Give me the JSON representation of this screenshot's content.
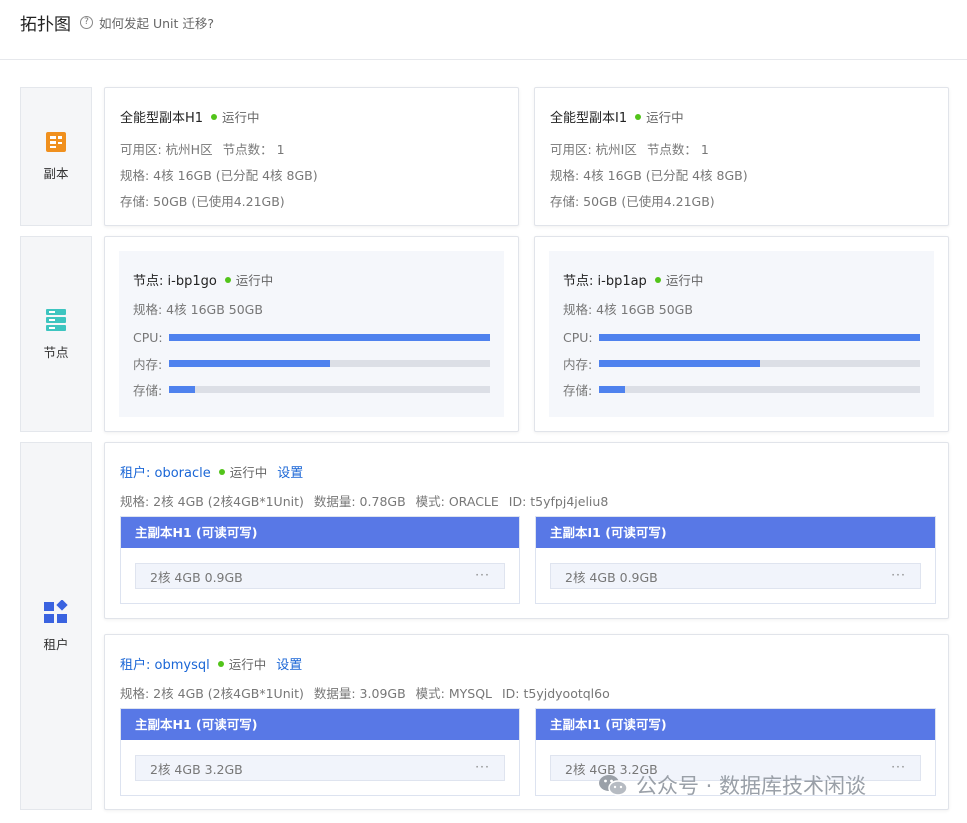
{
  "header": {
    "title": "拓扑图",
    "help_text": "如何发起 Unit 迁移?",
    "help_icon": "question-circle-icon"
  },
  "colors": {
    "accent_blue": "#4f82ee",
    "unit_header": "#5878e6",
    "status_running": "#52c41a",
    "replica_icon": "#f0901e",
    "node_icon": "#3dc5c0",
    "tenant_icon": "#3a63e0",
    "link": "#1a66d6"
  },
  "sections": {
    "replica": {
      "label": "副本",
      "icon": "replica-document-icon"
    },
    "node": {
      "label": "节点",
      "icon": "server-stack-icon"
    },
    "tenant": {
      "label": "租户",
      "icon": "tenant-blocks-icon"
    }
  },
  "replicas": [
    {
      "name": "全能型副本H1",
      "status": "运行中",
      "zone": "可用区: 杭州H区",
      "node_count": "节点数： 1",
      "spec": "规格: 4核 16GB (已分配  4核 8GB)",
      "storage": "存储: 50GB  (已使用4.21GB)"
    },
    {
      "name": "全能型副本I1",
      "status": "运行中",
      "zone": "可用区: 杭州I区",
      "node_count": "节点数： 1",
      "spec": "规格: 4核 16GB (已分配  4核 8GB)",
      "storage": "存储: 50GB  (已使用4.21GB)"
    }
  ],
  "nodes": [
    {
      "title": "节点: i-bp1go",
      "status": "运行中",
      "spec": "规格: 4核   16GB   50GB",
      "bars": [
        {
          "label": "CPU:",
          "fraction": 1.0
        },
        {
          "label": "内存:",
          "fraction": 0.5
        },
        {
          "label": "存储:",
          "fraction": 0.08
        }
      ]
    },
    {
      "title": "节点: i-bp1ap",
      "status": "运行中",
      "spec": "规格: 4核   16GB   50GB",
      "bars": [
        {
          "label": "CPU:",
          "fraction": 1.0
        },
        {
          "label": "内存:",
          "fraction": 0.5
        },
        {
          "label": "存储:",
          "fraction": 0.08
        }
      ]
    }
  ],
  "tenants": [
    {
      "name": "租户: oboracle",
      "status": "运行中",
      "settings": "设置",
      "spec": "规格: 2核 4GB (2核4GB*1Unit)",
      "data_size": "数据量: 0.78GB",
      "mode": "模式: ORACLE",
      "id": "ID: t5yfpj4jeliu8",
      "units": [
        {
          "title": "主副本H1 (可读可写)",
          "spec": "2核   4GB   0.9GB",
          "more": "···"
        },
        {
          "title": "主副本I1 (可读可写)",
          "spec": "2核   4GB   0.9GB",
          "more": "···"
        }
      ]
    },
    {
      "name": "租户: obmysql",
      "status": "运行中",
      "settings": "设置",
      "spec": "规格: 2核 4GB (2核4GB*1Unit)",
      "data_size": "数据量: 3.09GB",
      "mode": "模式: MYSQL",
      "id": "ID: t5yjdyootql6o",
      "units": [
        {
          "title": "主副本H1 (可读可写)",
          "spec": "2核   4GB   3.2GB",
          "more": "···"
        },
        {
          "title": "主副本I1 (可读可写)",
          "spec": "2核   4GB   3.2GB",
          "more": "···"
        }
      ]
    }
  ],
  "watermark": {
    "text": "公众号 · 数据库技术闲谈",
    "icon": "wechat-icon"
  }
}
